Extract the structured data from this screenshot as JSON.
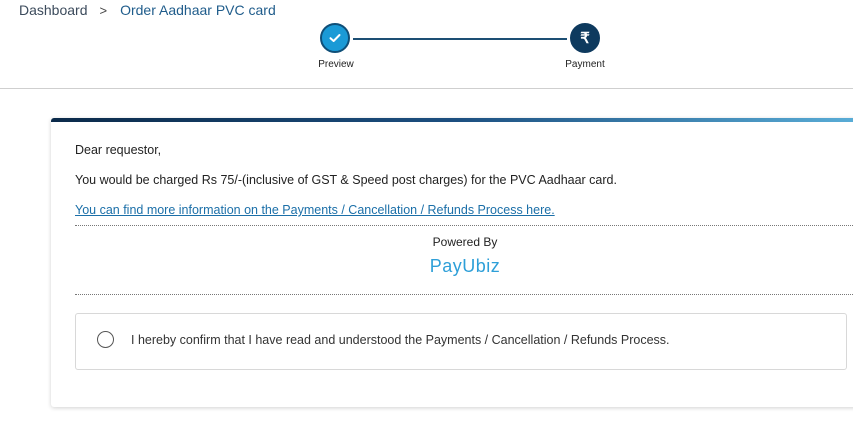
{
  "breadcrumb": {
    "home": "Dashboard",
    "separator": ">",
    "current": "Order Aadhaar PVC card"
  },
  "stepper": {
    "steps": [
      {
        "label": "Preview",
        "status": "completed",
        "icon": "check-icon"
      },
      {
        "label": "Payment",
        "status": "active",
        "icon": "rupee-icon",
        "glyph": "₹"
      }
    ]
  },
  "card": {
    "greeting": "Dear requestor,",
    "charge_text": "You would be charged Rs 75/-(inclusive of GST & Speed post charges) for the PVC Aadhaar card.",
    "info_link": "You can find more information on the Payments / Cancellation / Refunds Process here.",
    "powered_by": "Powered By",
    "payu_logo": "PayUbiz",
    "confirm_text": "I hereby confirm that I have read and understood the Payments / Cancellation / Refunds Process.",
    "confirm_checked": false
  },
  "colors": {
    "accent": "#1a9ad6",
    "dark": "#0e3a5e",
    "link": "#1b6fa8"
  }
}
